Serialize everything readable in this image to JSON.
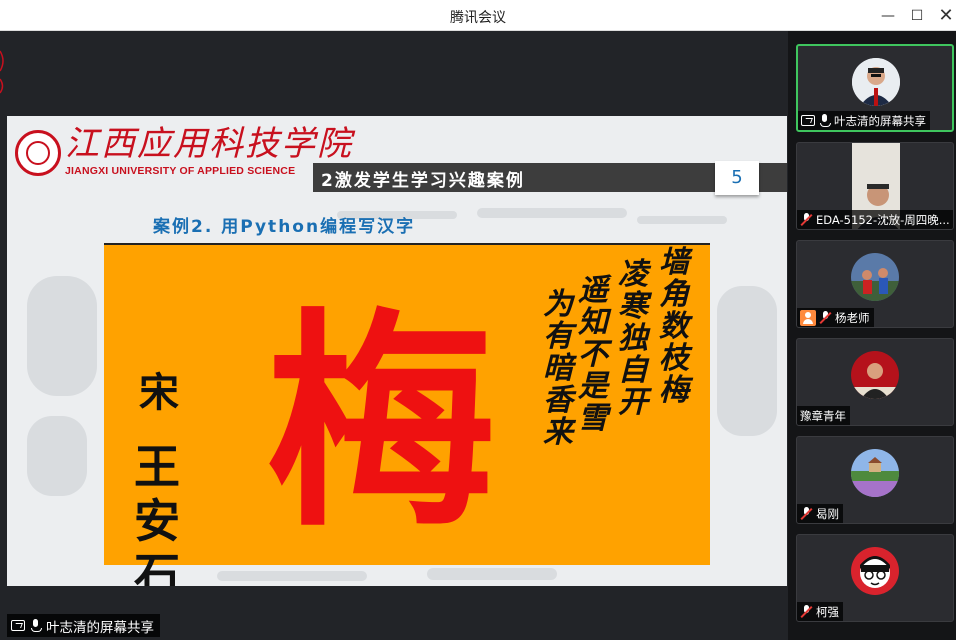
{
  "window": {
    "title": "腾讯会议"
  },
  "slide": {
    "school_name_cn": "江西应用科技学院",
    "school_name_en": "JIANGXI UNIVERSITY OF APPLIED SCIENCE",
    "section_title": "2激发学生学习兴趣案例",
    "page_number": "5",
    "case_title": "案例2. 用Python编程写汉字",
    "art": {
      "big_character": "梅",
      "author_dynasty": "宋",
      "author_name": "王安石",
      "poem_lines": [
        "墙角数枝梅",
        "凌寒独自开",
        "遥知不是雪",
        "为有暗香来"
      ]
    }
  },
  "share_status": {
    "label": "叶志清的屏幕共享"
  },
  "participants": [
    {
      "name": "叶志清的屏幕共享",
      "mic": "on",
      "sharing": true
    },
    {
      "name": "EDA-5152-沈放-周四晚...",
      "mic": "muted"
    },
    {
      "name": "杨老师",
      "mic": "muted",
      "badge": "user-icon"
    },
    {
      "name": "豫章青年",
      "mic": "none"
    },
    {
      "name": "曷刚",
      "mic": "muted"
    },
    {
      "name": "柯强",
      "mic": "muted"
    }
  ],
  "colors": {
    "accent_green": "#3fc65e",
    "brand_red": "#c8101e",
    "art_orange": "#ffa200",
    "title_blue": "#1a6fb3"
  }
}
